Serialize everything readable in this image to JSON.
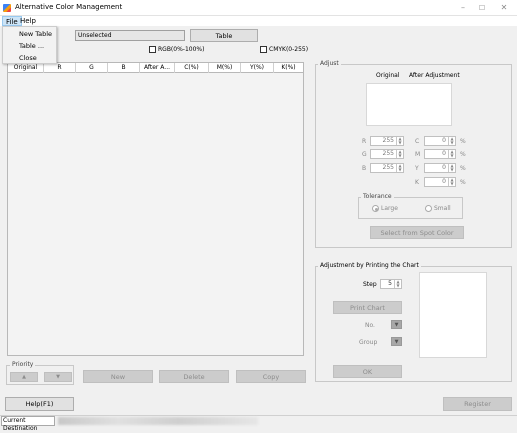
{
  "window": {
    "title": "Alternative Color Management",
    "controls": [
      "–",
      "☐",
      "✕"
    ]
  },
  "menubar": {
    "file": "File",
    "help": "Help"
  },
  "file_menu": [
    "New Table",
    "Table ...",
    "Close"
  ],
  "top": {
    "selection_value": "Unselected",
    "table_button": "Table",
    "rgb_checkbox": "RGB(0%-100%)",
    "cmyk_checkbox": "CMYK(0-255)"
  },
  "table": {
    "columns": [
      "Original",
      "R",
      "G",
      "B",
      "After A...",
      "C(%)",
      "M(%)",
      "Y(%)",
      "K(%)"
    ],
    "rows": []
  },
  "priority": {
    "label": "Priority",
    "up": "▲",
    "down": "▼"
  },
  "actions": {
    "new": "New",
    "delete": "Delete",
    "copy": "Copy"
  },
  "adjust": {
    "label": "Adjust",
    "original_header": "Original",
    "after_header": "After Adjustment",
    "fields": {
      "r": {
        "label": "R",
        "value": "255"
      },
      "g": {
        "label": "G",
        "value": "255"
      },
      "b": {
        "label": "B",
        "value": "255"
      },
      "c": {
        "label": "C",
        "value": "0"
      },
      "m": {
        "label": "M",
        "value": "0"
      },
      "y": {
        "label": "Y",
        "value": "0"
      },
      "k": {
        "label": "K",
        "value": "0"
      },
      "pct": "%"
    },
    "tolerance": {
      "label": "Tolerance",
      "large": "Large",
      "small": "Small"
    },
    "select_spot_button": "Select from Spot Color"
  },
  "chart_adjust": {
    "label": "Adjustment by Printing the Chart",
    "step_label": "Step",
    "step_value": "5",
    "print_button": "Print Chart",
    "no_label": "No.",
    "group_label": "Group",
    "ok_button": "OK"
  },
  "bottom": {
    "help_button": "Help(F1)",
    "register_button": "Register"
  },
  "status": {
    "label": "Current Destination"
  }
}
